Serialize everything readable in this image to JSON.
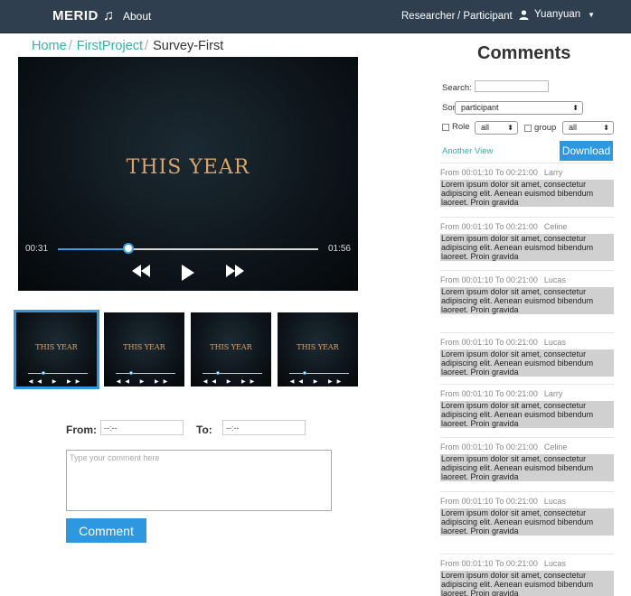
{
  "navbar": {
    "brand": "MERID",
    "brand_icon": "music-note-icon",
    "about": "About",
    "researcher": "Researcher",
    "participant": "/ Participant",
    "user": "Yuanyuan"
  },
  "breadcrumb": {
    "home": "Home",
    "project": "FirstProject",
    "current": "Survey-First",
    "sep": "/"
  },
  "player": {
    "title": "THIS YEAR",
    "current_time": "00:31",
    "duration": "01:56",
    "progress": 0.27
  },
  "thumbnails": [
    {
      "title": "THIS YEAR",
      "active": true
    },
    {
      "title": "THIS YEAR",
      "active": false
    },
    {
      "title": "THIS YEAR",
      "active": false
    },
    {
      "title": "THIS YEAR",
      "active": false
    }
  ],
  "form": {
    "from_label": "From:",
    "from_value": "--:--",
    "to_label": "To:",
    "to_value": "--:--",
    "comment_placeholder": "Type your comment here",
    "comment_button": "Comment"
  },
  "comments_panel": {
    "heading": "Comments",
    "search_label": "Search:",
    "search_value": "",
    "sort_label": "Sort By:",
    "sort_value": "participant",
    "role_label": "Role",
    "role_value": "all",
    "group_label": "group",
    "group_value": "all",
    "another_view": "Another View",
    "download": "Download",
    "accent_color": "#2d98e0",
    "link_color": "#33b4a4"
  },
  "comments": [
    {
      "range": "From 00:01:10 To 00:21:00",
      "name": "Larry",
      "text": "Lorem ipsum dolor sit amet, consectetur adipiscing elit. Aenean euismod bibendum laoreet. Proin gravida"
    },
    {
      "range": "From 00:01:10 To 00:21:00",
      "name": "Celine",
      "text": "Lorem ipsum dolor sit amet, consectetur adipiscing elit. Aenean euismod bibendum laoreet. Proin gravida"
    },
    {
      "range": "From 00:01:10 To 00:21:00",
      "name": "Lucas",
      "text": "Lorem ipsum dolor sit amet, consectetur adipiscing elit. Aenean euismod bibendum laoreet. Proin gravida"
    },
    {
      "range": "From 00:01:10 To 00:21:00",
      "name": "Lucas",
      "text": "Lorem ipsum dolor sit amet, consectetur adipiscing elit. Aenean euismod bibendum laoreet. Proin gravida"
    },
    {
      "range": "From 00:01:10 To 00:21:00",
      "name": "Larry",
      "text": "Lorem ipsum dolor sit amet, consectetur adipiscing elit. Aenean euismod bibendum laoreet. Proin gravida"
    },
    {
      "range": "From 00:01:10 To 00:21:00",
      "name": "Celine",
      "text": "Lorem ipsum dolor sit amet, consectetur adipiscing elit. Aenean euismod bibendum laoreet. Proin gravida"
    },
    {
      "range": "From 00:01:10 To 00:21:00",
      "name": "Lucas",
      "text": "Lorem ipsum dolor sit amet, consectetur adipiscing elit. Aenean euismod bibendum laoreet. Proin gravida"
    },
    {
      "range": "From 00:01:10 To 00:21:00",
      "name": "Lucas",
      "text": "Lorem ipsum dolor sit amet, consectetur adipiscing elit. Aenean euismod bibendum laoreet. Proin gravida"
    }
  ]
}
